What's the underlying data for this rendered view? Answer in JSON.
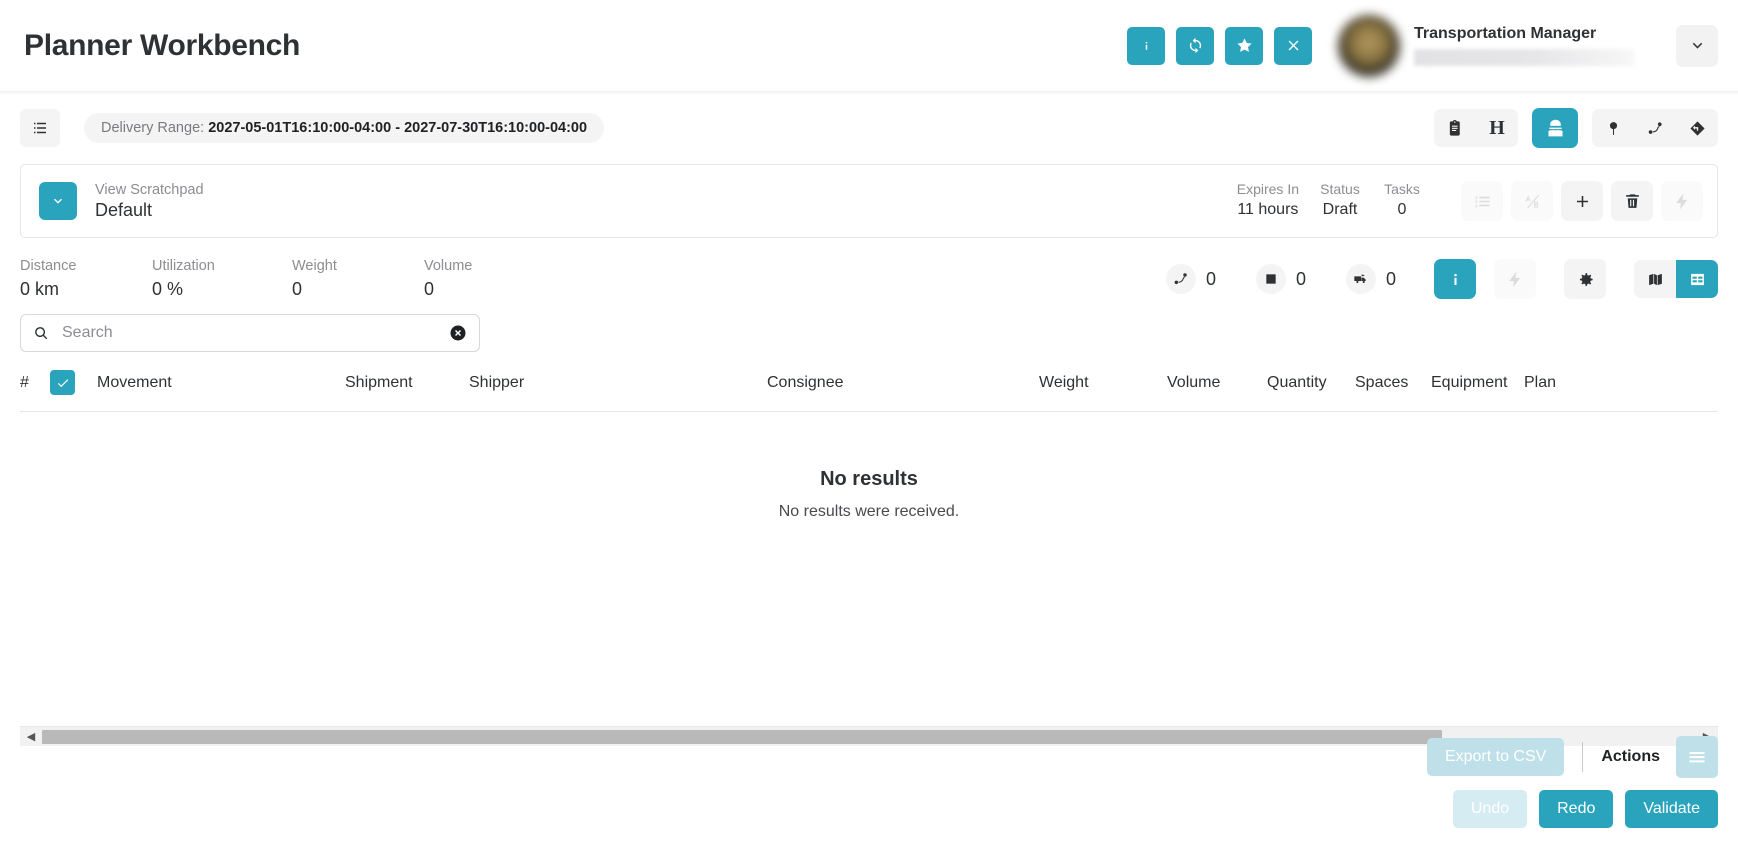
{
  "header": {
    "title": "Planner Workbench",
    "actions": [
      {
        "name": "info-button",
        "icon": "info-icon",
        "glyph": "i"
      },
      {
        "name": "refresh-button",
        "icon": "refresh-icon",
        "glyph": "↻"
      },
      {
        "name": "favorite-button",
        "icon": "star-icon",
        "glyph": "★"
      },
      {
        "name": "close-button",
        "icon": "close-icon",
        "glyph": "✕"
      }
    ],
    "user": {
      "role": "Transportation Manager",
      "avatar": "user-avatar"
    },
    "dropdown_icon": "chevron-down-icon",
    "accent": "#2aa3bd"
  },
  "toolbar": {
    "menu_icon": "list-menu-icon",
    "delivery_range_label": "Delivery Range:",
    "delivery_range_value": "2027-05-01T16:10:00-04:00 - 2027-07-30T16:10:00-04:00",
    "right_icons": [
      {
        "name": "clipboard-button",
        "icon": "clipboard-icon"
      },
      {
        "name": "history-button",
        "icon": "letter-h-icon",
        "label": "H"
      },
      {
        "name": "planner-persona-button",
        "icon": "user-ninja-icon",
        "active": true
      },
      {
        "name": "map-pin-button",
        "icon": "map-pin-icon"
      },
      {
        "name": "route-button",
        "icon": "route-icon"
      },
      {
        "name": "directions-button",
        "icon": "diamond-turn-icon"
      }
    ]
  },
  "scratchpad": {
    "expand_icon": "chevron-down-icon",
    "label": "View Scratchpad",
    "value": "Default",
    "stats": [
      {
        "label": "Expires In",
        "value": "11 hours"
      },
      {
        "label": "Status",
        "value": "Draft"
      },
      {
        "label": "Tasks",
        "value": "0"
      }
    ],
    "icons": [
      {
        "name": "ordered-list-button",
        "icon": "ordered-list-icon",
        "disabled": true
      },
      {
        "name": "compare-ab-button",
        "icon": "ab-compare-icon",
        "disabled": true
      },
      {
        "name": "add-button",
        "icon": "plus-icon",
        "disabled": false
      },
      {
        "name": "delete-button",
        "icon": "trash-icon",
        "disabled": false
      },
      {
        "name": "bolt-button",
        "icon": "bolt-icon",
        "disabled": true
      }
    ]
  },
  "kpis": [
    {
      "label": "Distance",
      "value": "0 km"
    },
    {
      "label": "Utilization",
      "value": "0 %"
    },
    {
      "label": "Weight",
      "value": "0"
    },
    {
      "label": "Volume",
      "value": "0"
    }
  ],
  "counters": [
    {
      "name": "routes-count",
      "icon": "route-icon",
      "value": "0"
    },
    {
      "name": "stops-count",
      "icon": "square-icon",
      "value": "0"
    },
    {
      "name": "trucks-count",
      "icon": "truck-icon",
      "value": "0"
    }
  ],
  "view_controls": [
    {
      "name": "info-toggle",
      "icon": "info-icon",
      "active": true
    },
    {
      "name": "bolt-toggle",
      "icon": "bolt-icon",
      "disabled": true
    },
    {
      "name": "settings-button",
      "icon": "gear-icon"
    },
    {
      "name": "map-view-toggle",
      "icon": "map-icon",
      "active": false
    },
    {
      "name": "grid-view-toggle",
      "icon": "grid-icon",
      "active": true
    }
  ],
  "search": {
    "placeholder": "Search",
    "value": "",
    "search_icon": "search-icon",
    "clear_icon": "clear-circle-icon"
  },
  "table": {
    "columns": [
      "#",
      "Movement",
      "Shipment",
      "Shipper",
      "Consignee",
      "Weight",
      "Volume",
      "Quantity",
      "Spaces",
      "Equipment",
      "Plan"
    ],
    "select_all_checked": true,
    "empty_title": "No results",
    "empty_message": "No results were received."
  },
  "bottom": {
    "export_label": "Export to CSV",
    "actions_label": "Actions",
    "burger_icon": "hamburger-menu-icon",
    "undo_label": "Undo",
    "redo_label": "Redo",
    "validate_label": "Validate"
  }
}
